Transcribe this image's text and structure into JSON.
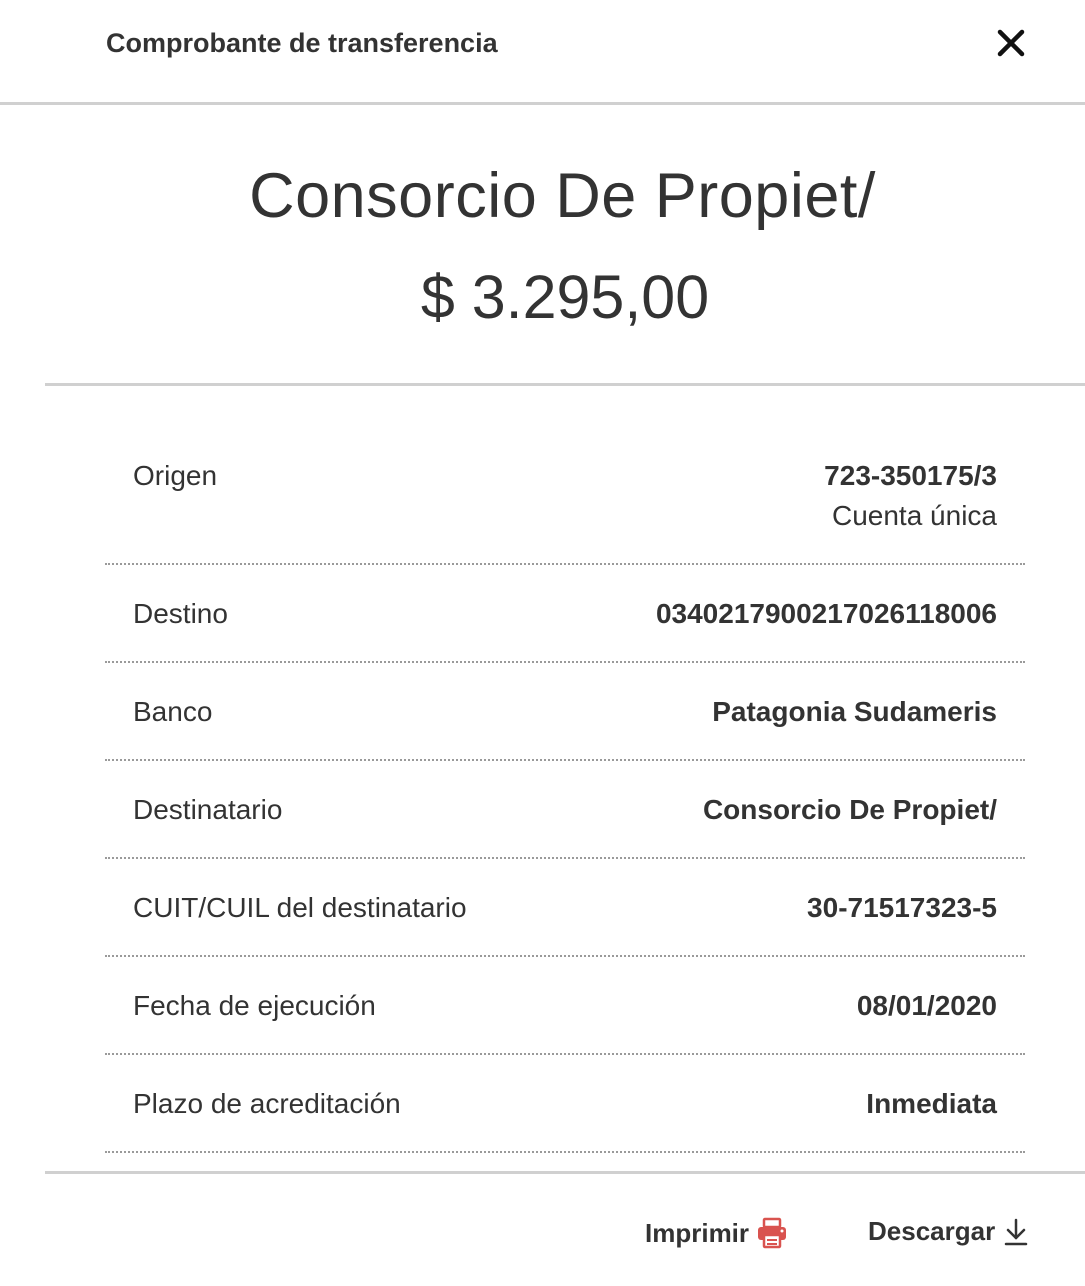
{
  "header": {
    "title": "Comprobante de transferencia",
    "close_icon": "close-icon"
  },
  "summary": {
    "recipient": "Consorcio De Propiet/",
    "amount": "$ 3.295,00"
  },
  "details": {
    "origen": {
      "label": "Origen",
      "value": "723-350175/3",
      "subvalue": "Cuenta única"
    },
    "destino": {
      "label": "Destino",
      "value": "0340217900217026118006"
    },
    "banco": {
      "label": "Banco",
      "value": "Patagonia Sudameris"
    },
    "destinatario": {
      "label": "Destinatario",
      "value": "Consorcio De Propiet/"
    },
    "cuit": {
      "label": "CUIT/CUIL del destinatario",
      "value": "30-71517323-5"
    },
    "fecha": {
      "label": "Fecha de ejecución",
      "value": "08/01/2020"
    },
    "plazo": {
      "label": "Plazo de acreditación",
      "value": "Inmediata"
    }
  },
  "actions": {
    "print_label": "Imprimir",
    "print_icon": "printer-icon",
    "download_label": "Descargar",
    "download_icon": "download-icon"
  },
  "colors": {
    "text": "#333333",
    "divider": "#d0d0d0",
    "print_icon": "#d9534f"
  }
}
